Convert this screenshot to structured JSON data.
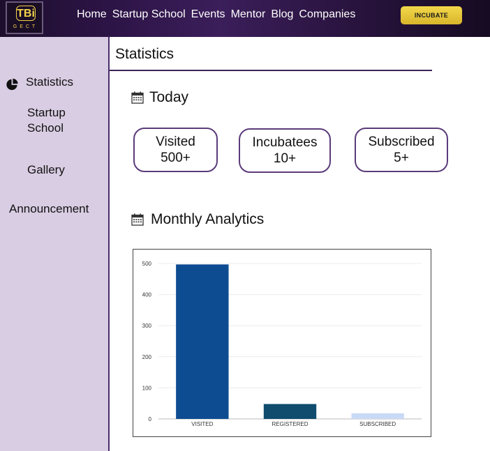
{
  "brand": {
    "logo_text": "TBi",
    "logo_sub": "GECT"
  },
  "nav": {
    "items": [
      "Home",
      "Startup School",
      "Events",
      "Mentor",
      "Blog",
      "Companies"
    ],
    "cta_label": "INCUBATE"
  },
  "sidebar": {
    "items": [
      {
        "label": "Statistics",
        "icon": "pie-chart-icon"
      },
      {
        "label": "Startup School"
      },
      {
        "label": "Gallery"
      },
      {
        "label": "Announcement"
      }
    ]
  },
  "main": {
    "title": "Statistics",
    "today": {
      "heading": "Today",
      "icon": "calendar-icon",
      "cards": [
        {
          "label": "Visited",
          "value": "500+"
        },
        {
          "label": "Incubatees",
          "value": "10+"
        },
        {
          "label": "Subscribed",
          "value": "5+"
        }
      ]
    },
    "monthly": {
      "heading": "Monthly Analytics",
      "icon": "calendar-icon"
    }
  },
  "colors": {
    "header_bg": "#2b1344",
    "sidebar_bg": "#d9cde3",
    "accent": "#5b3b7a",
    "cta": "#e8c63a"
  },
  "chart_data": {
    "type": "bar",
    "categories": [
      "VISITED",
      "REGISTERED",
      "SUBSCRIBED"
    ],
    "values": [
      497,
      48,
      18
    ],
    "colors": [
      "#0e4c92",
      "#0f4c6e",
      "#c9daf6"
    ],
    "yticks": [
      0,
      100,
      200,
      300,
      400,
      500
    ],
    "ylim": [
      0,
      500
    ],
    "grid": true,
    "legend": "none"
  }
}
